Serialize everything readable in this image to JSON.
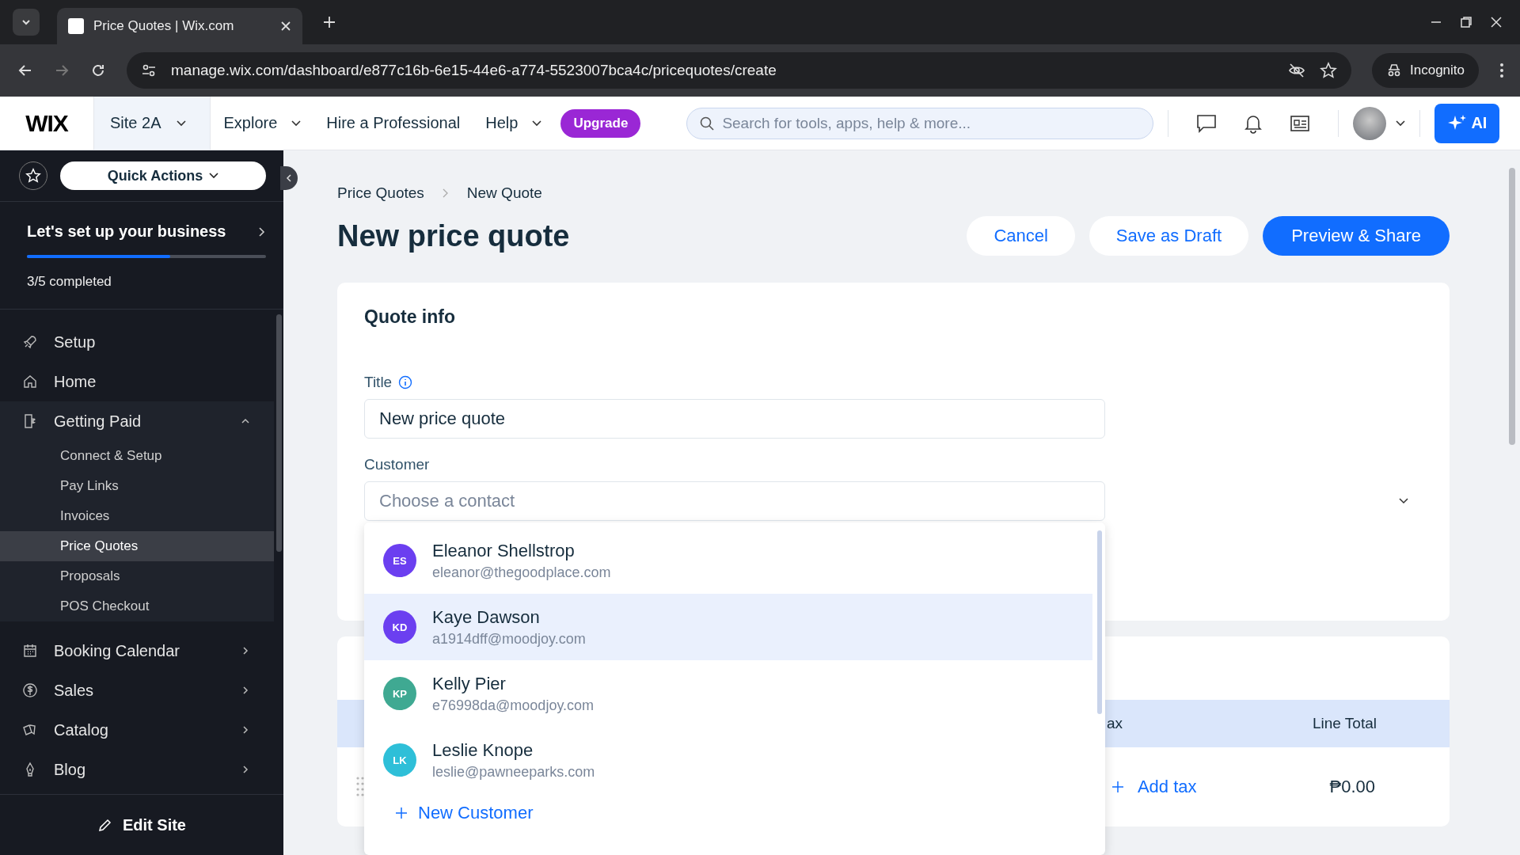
{
  "browser": {
    "tab_title": "Price Quotes | Wix.com",
    "url": "manage.wix.com/dashboard/e877c16b-6e15-44e6-a774-5523007bca4c/pricequotes/create",
    "incognito_label": "Incognito"
  },
  "header": {
    "logo": "WIX",
    "site": "Site 2A",
    "nav": [
      {
        "label": "Explore",
        "kind": "menu"
      },
      {
        "label": "Hire a Professional",
        "kind": "link"
      },
      {
        "label": "Help",
        "kind": "menu"
      }
    ],
    "upgrade": "Upgrade",
    "search": {
      "placeholder": "Search for tools, apps, help & more..."
    },
    "ai_button": "AI"
  },
  "sidebar": {
    "quick_actions": "Quick Actions",
    "setup": {
      "title": "Let's set up your business",
      "level": 0.6,
      "progress_text": "3/5 completed"
    },
    "items": [
      {
        "label": "Setup",
        "kind": "link",
        "expanded": false
      },
      {
        "label": "Home",
        "kind": "link",
        "expanded": false
      },
      {
        "label": "Getting Paid",
        "kind": "section",
        "expanded": true,
        "children": [
          {
            "label": "Connect & Setup",
            "selected": false
          },
          {
            "label": "Pay Links",
            "selected": false
          },
          {
            "label": "Invoices",
            "selected": false
          },
          {
            "label": "Price Quotes",
            "selected": true
          },
          {
            "label": "Proposals",
            "selected": false
          },
          {
            "label": "POS Checkout",
            "selected": false
          }
        ]
      },
      {
        "label": "Booking Calendar",
        "kind": "section",
        "expanded": false
      },
      {
        "label": "Sales",
        "kind": "section",
        "expanded": false
      },
      {
        "label": "Catalog",
        "kind": "section",
        "expanded": false
      },
      {
        "label": "Blog",
        "kind": "section",
        "expanded": false
      }
    ],
    "edit_site": "Edit Site"
  },
  "page": {
    "breadcrumb": [
      "Price Quotes",
      "New Quote"
    ],
    "title": "New price quote",
    "buttons": [
      {
        "label": "Cancel",
        "kind": "secondary"
      },
      {
        "label": "Save as Draft",
        "kind": "secondary"
      },
      {
        "label": "Preview & Share",
        "kind": "primary"
      }
    ],
    "quote_info": {
      "title": "Quote info",
      "title_field": {
        "label": "Title",
        "value": "New price quote"
      },
      "customer_field": {
        "label": "Customer",
        "placeholder": "Choose a contact"
      },
      "contacts": [
        {
          "initials": "ES",
          "name": "Eleanor Shellstrop",
          "email": "eleanor@thegoodplace.com",
          "color": "#6b3ff0",
          "selected": false
        },
        {
          "initials": "KD",
          "name": "Kaye Dawson",
          "email": "a1914dff@moodjoy.com",
          "color": "#6b3ff0",
          "selected": true
        },
        {
          "initials": "KP",
          "name": "Kelly Pier",
          "email": "e76998da@moodjoy.com",
          "color": "#3fa992",
          "selected": false
        },
        {
          "initials": "LK",
          "name": "Leslie Knope",
          "email": "leslie@pawneeparks.com",
          "color": "#2ebfd8",
          "selected": false
        }
      ],
      "new_customer": "New Customer"
    },
    "items_table": {
      "columns": [
        "ax",
        "Line Total"
      ],
      "row": {
        "add_tax": "Add tax",
        "line_total": "₱0.00"
      }
    }
  }
}
